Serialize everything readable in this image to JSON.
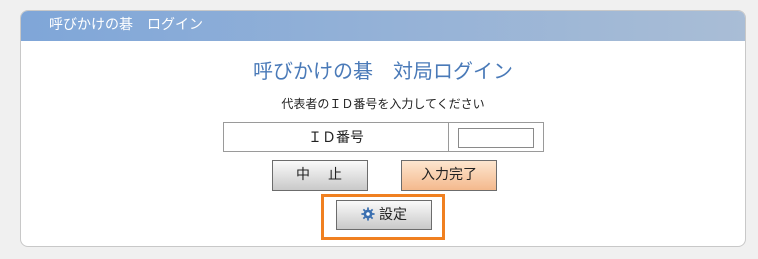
{
  "header": {
    "title": "呼びかけの碁　ログイン"
  },
  "main": {
    "title": "呼びかけの碁　対局ログイン",
    "subtitle": "代表者のＩＤ番号を入力してください",
    "id_label": "ＩＤ番号",
    "id_value": ""
  },
  "buttons": {
    "cancel_label": "中　止",
    "submit_label": "入力完了",
    "settings_label": "設定"
  },
  "icons": {
    "settings": "gear-icon"
  },
  "colors": {
    "header_bg": "#7fa6d8",
    "title_text": "#4a7ab8",
    "submit_bg": "#f4b98d",
    "highlight": "#f08020",
    "gear": "#3a6fb0"
  }
}
